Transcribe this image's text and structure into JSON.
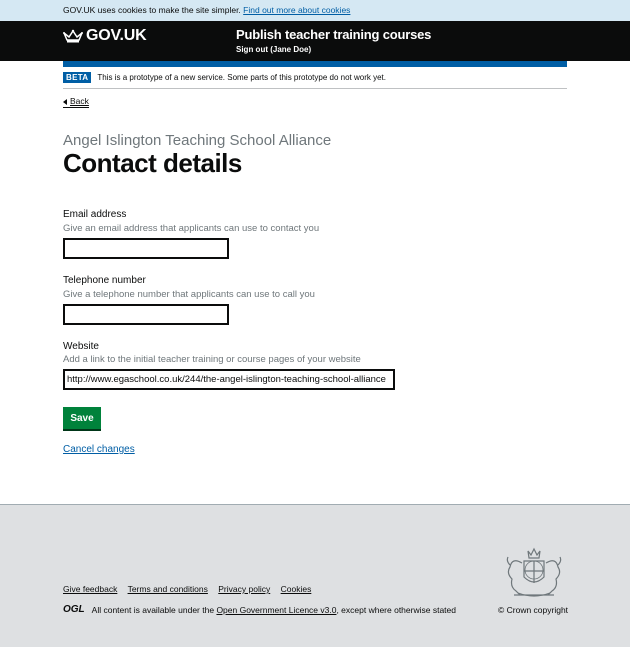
{
  "cookie_banner": {
    "text": "GOV.UK uses cookies to make the site simpler.",
    "link": "Find out more about cookies"
  },
  "header": {
    "logo_text": "GOV.UK",
    "service_name": "Publish teacher training courses",
    "sign_out": "Sign out (Jane Doe)"
  },
  "phase_banner": {
    "tag": "BETA",
    "text": "This is a prototype of a new service. Some parts of this prototype do not work yet."
  },
  "back_link": "Back",
  "page": {
    "caption": "Angel Islington Teaching School Alliance",
    "title": "Contact details"
  },
  "form": {
    "email": {
      "label": "Email address",
      "hint": "Give an email address that applicants can use to contact you",
      "value": ""
    },
    "telephone": {
      "label": "Telephone number",
      "hint": "Give a telephone number that applicants can use to call you",
      "value": ""
    },
    "website": {
      "label": "Website",
      "hint": "Add a link to the initial teacher training or course pages of your website",
      "value": "http://www.egaschool.co.uk/244/the-angel-islington-teaching-school-alliance"
    },
    "save_label": "Save",
    "cancel_label": "Cancel changes"
  },
  "footer": {
    "links": [
      "Give feedback",
      "Terms and conditions",
      "Privacy policy",
      "Cookies"
    ],
    "ogl_logo": "OGL",
    "licence_prefix": "All content is available under the",
    "licence_link": "Open Government Licence v3.0",
    "licence_suffix": ", except where otherwise stated",
    "copyright": "© Crown copyright"
  },
  "colors": {
    "header_bg": "#0b0c0c",
    "brand_blue": "#005ea5",
    "button_green": "#00823b",
    "cookie_bg": "#d5e8f3",
    "footer_bg": "#dee0e2"
  }
}
